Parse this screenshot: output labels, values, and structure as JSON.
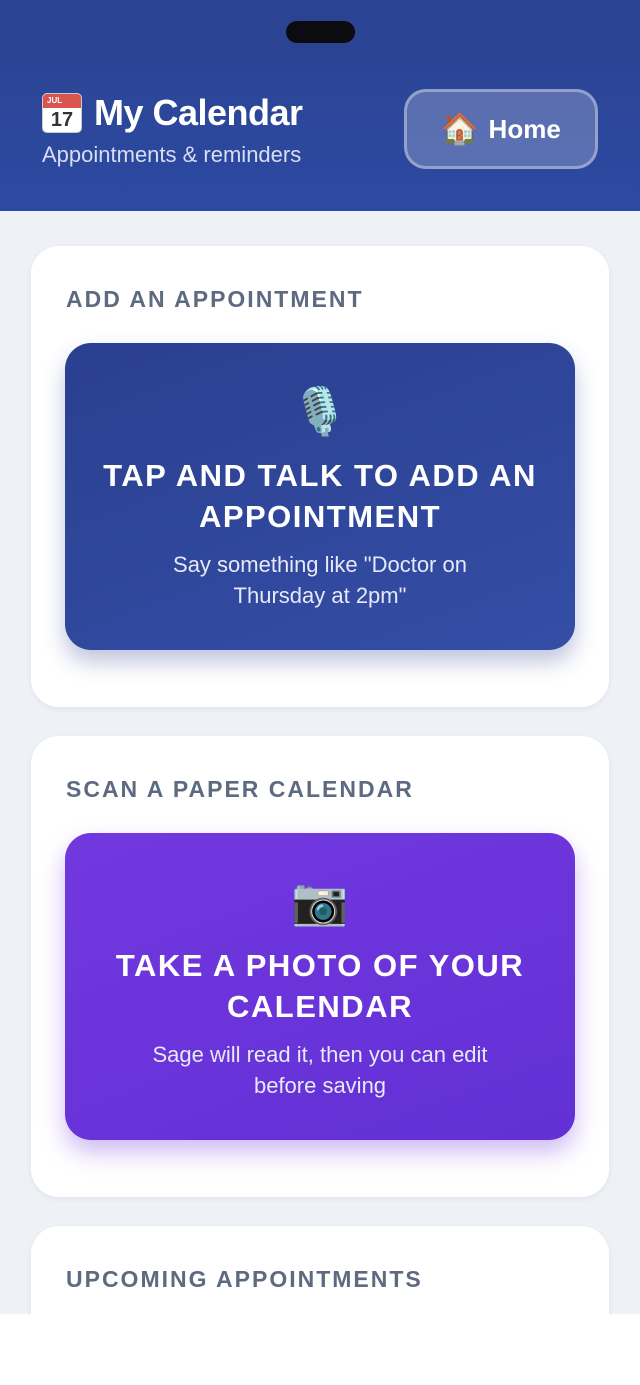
{
  "header": {
    "title": "My Calendar",
    "subtitle": "Appointments & reminders",
    "calendar_icon_month": "JUL",
    "calendar_icon_day": "17",
    "home_button": {
      "label": "Home",
      "icon": "🏠"
    }
  },
  "sections": {
    "add": {
      "label": "ADD AN APPOINTMENT",
      "button": {
        "icon": "🎙️",
        "title": "TAP AND TALK TO ADD AN APPOINTMENT",
        "subtitle": "Say something like \"Doctor on Thursday at 2pm\""
      }
    },
    "scan": {
      "label": "SCAN A PAPER CALENDAR",
      "button": {
        "icon": "📷",
        "title": "TAKE A PHOTO OF YOUR CALENDAR",
        "subtitle": "Sage will read it, then you can edit before saving"
      }
    },
    "upcoming": {
      "label": "UPCOMING APPOINTMENTS"
    }
  },
  "colors": {
    "header_bg": "#2b4596",
    "voice_button": "#2f4597",
    "photo_button": "#6a34da",
    "page_bg": "#eef1f6"
  }
}
